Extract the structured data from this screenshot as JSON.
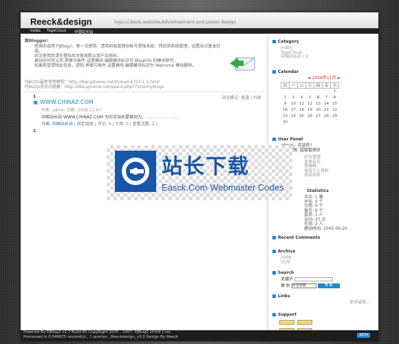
{
  "header": {
    "logo": "Reeck&design",
    "tagline": "logo,vi,book,website,Advertisement and poster design"
  },
  "nav": {
    "items": [
      "Index",
      "TagsCloud",
      "中国站长站"
    ]
  },
  "welcome": {
    "title": "致Blogger:",
    "line1": "感谢你选用 PJBlog2，第一次使用，请用初始管理员帐号登陆系统，然后到系统管理，设置站点基本信息。",
    "line2": "初次使用后请在登陆后台修改默认用户及密码。",
    "line3": "建站时间可以到 界面与插件-设置模块 编辑模块标识为 BlogInfo 的模块即可。",
    "line4": "如果希望清除此信息，请到 界面与插件-设置模块 编辑模块标识为 Welcome 模块删除。",
    "link1": "PJBLOG最新使用教程：http://bbs.pjhome.net/thread-4753-1-1.html",
    "link2": "PJBLOG常见问题集：http://bbs.pjhome.net/space.php?7924/myblogs"
  },
  "post": {
    "num": "1",
    "toolbar": "浏览模式: 普通 | 列表",
    "title": "WWW.CHINAZ.COM",
    "meta": "作者: admin 日期: 2008-11-07",
    "body": "中国站长站 WWW.CHINAZ.COM 为中文站长提供动力。. . . . . . . . . . . . .",
    "footer_cat": "分类: 中国站长站",
    "footer_links": "| 固定链接 | 评论: 0 | 引用: 0 | 查看次数: 2 |",
    "num2": "1"
  },
  "sidebar": {
    "category": {
      "title": "Category",
      "items": [
        "Index",
        "TagsCloud",
        "中国站长站 [1]"
      ]
    },
    "calendar": {
      "title": "Calendar",
      "month": "2008年11月",
      "weekdays": [
        "日",
        "一",
        "二",
        "三",
        "四",
        "五",
        "六"
      ],
      "weeks": [
        [
          "",
          "",
          "",
          "",
          "",
          "",
          "1"
        ],
        [
          "2",
          "3",
          "4",
          "5",
          "6",
          "7",
          "8"
        ],
        [
          "9",
          "10",
          "11",
          "12",
          "13",
          "14",
          "15"
        ],
        [
          "16",
          "17",
          "18",
          "19",
          "20",
          "21",
          "22"
        ],
        [
          "23",
          "24",
          "25",
          "26",
          "27",
          "28",
          "29"
        ],
        [
          "30",
          "",
          "",
          "",
          "",
          "",
          ""
        ]
      ],
      "today": "6"
    },
    "user": {
      "title": "User Panel",
      "greeting": "admin，欢迎你！",
      "role": "你的权限: 超级管理员",
      "links": [
        "后台管理",
        "发表日志",
        "草稿箱",
        "修改个人资料",
        "退出系统"
      ]
    },
    "stats": {
      "title": "Statistics",
      "lines": [
        "日志: 1 篇",
        "评论: 0 个",
        "引用: 0 个",
        "留言: 0 个",
        "会员: 1 人",
        "访问: 37 次",
        "在线: 2 人",
        "建站时间: 2005-06-20"
      ]
    },
    "recent": {
      "title": "Recent Comments"
    },
    "archive": {
      "title": "Archive",
      "items": [
        "2008",
        "05月"
      ]
    },
    "search": {
      "title": "Search",
      "label_kw": "关键字",
      "label_type": "类  别",
      "select_value": "日志标题",
      "button": "搜 索"
    },
    "links": {
      "title": "Links",
      "more": "更多链接..."
    },
    "support": {
      "title": "Support"
    }
  },
  "footer": {
    "line1": "Powered By PJBlog2 v2.7 Build 85 CopyRight 2005 - 2007, PJBlog2 xhtml | css",
    "line2": "Processed in 0.046875 second(s) , 1 queries , Reeckdesign_v3.0 Design By Reeck",
    "beta": "BETA"
  },
  "watermark": {
    "cn": "站长下载",
    "en": "Easck.Com Webmaster Codes"
  },
  "colors": {
    "accent": "#1a8bc7",
    "highlight": "#1a6fb0",
    "dark": "#222222"
  }
}
